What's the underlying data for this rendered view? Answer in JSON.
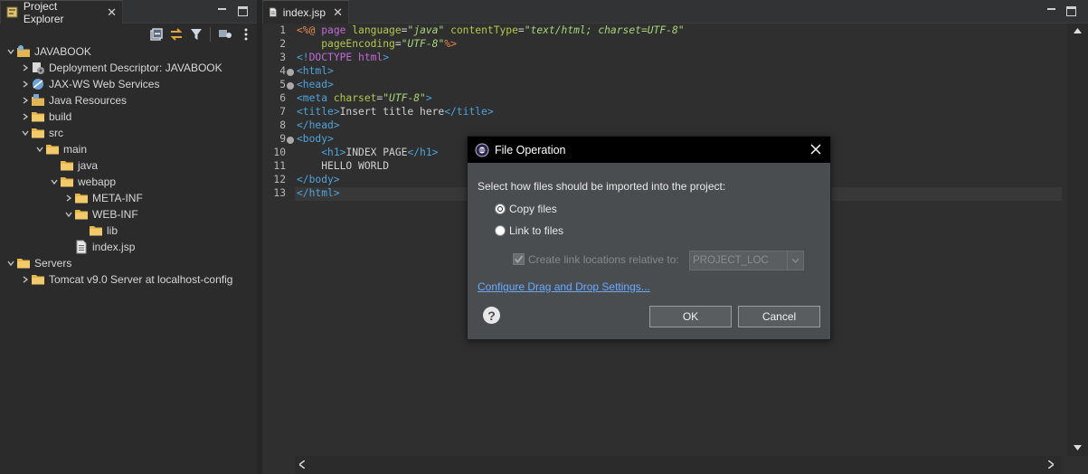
{
  "project_explorer": {
    "tab_label": "Project Explorer",
    "close_glyph": "✕",
    "toolbar": [
      "collapse-all-icon",
      "link-with-editor-icon",
      "filter-icon",
      "focus-icon",
      "view-menu-icon"
    ],
    "tree": [
      {
        "label": "JAVABOOK",
        "depth": 0,
        "expanded": true,
        "icon": "project-icon"
      },
      {
        "label": "Deployment Descriptor: JAVABOOK",
        "depth": 1,
        "expanded": false,
        "icon": "deployment-descriptor-icon"
      },
      {
        "label": "JAX-WS Web Services",
        "depth": 1,
        "expanded": false,
        "icon": "web-services-icon"
      },
      {
        "label": "Java Resources",
        "depth": 1,
        "expanded": false,
        "icon": "java-resources-icon"
      },
      {
        "label": "build",
        "depth": 1,
        "expanded": false,
        "icon": "folder-icon"
      },
      {
        "label": "src",
        "depth": 1,
        "expanded": true,
        "icon": "folder-icon"
      },
      {
        "label": "main",
        "depth": 2,
        "expanded": true,
        "icon": "folder-icon"
      },
      {
        "label": "java",
        "depth": 3,
        "expanded": null,
        "icon": "folder-icon"
      },
      {
        "label": "webapp",
        "depth": 3,
        "expanded": true,
        "icon": "folder-icon"
      },
      {
        "label": "META-INF",
        "depth": 4,
        "expanded": false,
        "icon": "folder-icon"
      },
      {
        "label": "WEB-INF",
        "depth": 4,
        "expanded": true,
        "icon": "folder-icon"
      },
      {
        "label": "lib",
        "depth": 5,
        "expanded": null,
        "icon": "folder-icon"
      },
      {
        "label": "index.jsp",
        "depth": 4,
        "expanded": null,
        "icon": "jsp-file-icon"
      },
      {
        "label": "Servers",
        "depth": 0,
        "expanded": true,
        "icon": "folder-icon"
      },
      {
        "label": "Tomcat v9.0 Server at localhost-config",
        "depth": 1,
        "expanded": false,
        "icon": "folder-icon"
      }
    ]
  },
  "editor": {
    "tab_label": "index.jsp",
    "close_glyph": "✕",
    "current_line": 13,
    "lines": [
      {
        "n": "1",
        "fold": false,
        "tokens": [
          [
            "k-jsp",
            "<%@ "
          ],
          [
            "k-kw",
            "page "
          ],
          [
            "k-attr",
            "language"
          ],
          [
            "",
            "="
          ],
          [
            "k-str",
            "\"java\""
          ],
          [
            "k-attr",
            " contentType"
          ],
          [
            "",
            "="
          ],
          [
            "k-str",
            "\"text/html; charset=UTF-8\""
          ]
        ]
      },
      {
        "n": "2",
        "fold": false,
        "tokens": [
          [
            "",
            "    "
          ],
          [
            "k-attr",
            "pageEncoding"
          ],
          [
            "",
            "="
          ],
          [
            "k-str",
            "\"UTF-8\""
          ],
          [
            "k-jsp",
            "%>"
          ]
        ]
      },
      {
        "n": "3",
        "fold": false,
        "tokens": [
          [
            "k-tag",
            "<!"
          ],
          [
            "k-doc",
            "DOCTYPE "
          ],
          [
            "k-doc",
            "html"
          ],
          [
            "k-tag",
            ">"
          ]
        ]
      },
      {
        "n": "4",
        "fold": true,
        "tokens": [
          [
            "k-tag",
            "<html>"
          ]
        ]
      },
      {
        "n": "5",
        "fold": true,
        "tokens": [
          [
            "k-tag",
            "<head>"
          ]
        ]
      },
      {
        "n": "6",
        "fold": false,
        "tokens": [
          [
            "k-tag",
            "<meta "
          ],
          [
            "k-attr",
            "charset"
          ],
          [
            "",
            "="
          ],
          [
            "k-str",
            "\"UTF-8\""
          ],
          [
            "k-tag",
            ">"
          ]
        ]
      },
      {
        "n": "7",
        "fold": false,
        "tokens": [
          [
            "k-tag",
            "<title>"
          ],
          [
            "",
            "Insert title here"
          ],
          [
            "k-tag",
            "</title>"
          ]
        ]
      },
      {
        "n": "8",
        "fold": false,
        "tokens": [
          [
            "k-tag",
            "</head>"
          ]
        ]
      },
      {
        "n": "9",
        "fold": true,
        "tokens": [
          [
            "k-tag",
            "<body>"
          ]
        ]
      },
      {
        "n": "10",
        "fold": false,
        "tokens": [
          [
            "",
            "    "
          ],
          [
            "k-tag",
            "<h1>"
          ],
          [
            "",
            "INDEX PAGE"
          ],
          [
            "k-tag",
            "</h1>"
          ]
        ]
      },
      {
        "n": "11",
        "fold": false,
        "tokens": [
          [
            "",
            "    HELLO WORLD"
          ]
        ]
      },
      {
        "n": "12",
        "fold": false,
        "tokens": [
          [
            "k-tag",
            "</body>"
          ]
        ]
      },
      {
        "n": "13",
        "fold": false,
        "tokens": [
          [
            "k-tag",
            "</html>"
          ]
        ]
      }
    ]
  },
  "dialog": {
    "title": "File Operation",
    "prompt": "Select how files should be imported into the project:",
    "option_copy": "Copy files",
    "option_link": "Link to files",
    "checkbox_label": "Create link locations relative to:",
    "combo_value": "PROJECT_LOC",
    "settings_link": "Configure Drag and Drop Settings...",
    "ok_label": "OK",
    "cancel_label": "Cancel",
    "selected_option": "copy"
  }
}
